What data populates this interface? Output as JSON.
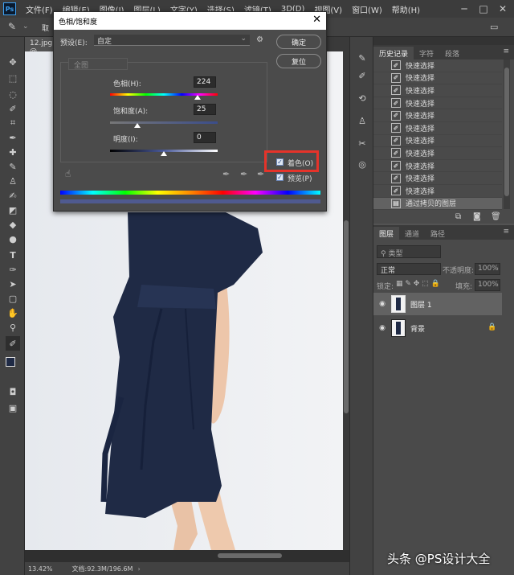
{
  "app": {
    "logo": "Ps"
  },
  "menu": [
    "文件(F)",
    "编辑(E)",
    "图像(I)",
    "图层(L)",
    "文字(Y)",
    "选择(S)",
    "滤镜(T)",
    "3D(D)",
    "视图(V)",
    "窗口(W)",
    "帮助(H)"
  ],
  "options_bar": {
    "tool_label": "取"
  },
  "document": {
    "tab_label": "12.jpg @"
  },
  "status": {
    "zoom": "13.42%",
    "doc_info": "文档:92.3M/196.6M"
  },
  "dialog": {
    "title": "色相/饱和度",
    "preset_label": "预设(E):",
    "preset_value": "自定",
    "ok": "确定",
    "reset": "复位",
    "channel": "全图",
    "hue_label": "色相(H):",
    "hue_value": "224",
    "hue_level": 0.81,
    "saturation_label": "饱和度(A):",
    "saturation_value": "25",
    "saturation_level": 0.25,
    "lightness_label": "明度(I):",
    "lightness_value": "0",
    "lightness_level": 0.5,
    "colorize_label": "着色(O)",
    "colorize_checked": true,
    "preview_label": "预览(P)",
    "preview_checked": true,
    "highlight_color": "#e5332a"
  },
  "history": {
    "tabs": [
      "历史记录",
      "字符",
      "段落"
    ],
    "items": [
      "快速选择",
      "快速选择",
      "快速选择",
      "快速选择",
      "快速选择",
      "快速选择",
      "快速选择",
      "快速选择",
      "快速选择",
      "快速选择",
      "快速选择"
    ],
    "last_item": "通过拷贝的图层"
  },
  "layers": {
    "tabs": [
      "图层",
      "通道",
      "路径"
    ],
    "filter": "类型",
    "blend_mode": "正常",
    "opacity_label": "不透明度:",
    "opacity_value": "100%",
    "lock_label": "锁定:",
    "fill_label": "填充:",
    "fill_value": "100%",
    "rows": [
      {
        "name": "图层 1"
      },
      {
        "name": "背景"
      }
    ]
  },
  "watermark": "头条 @PS设计大全"
}
